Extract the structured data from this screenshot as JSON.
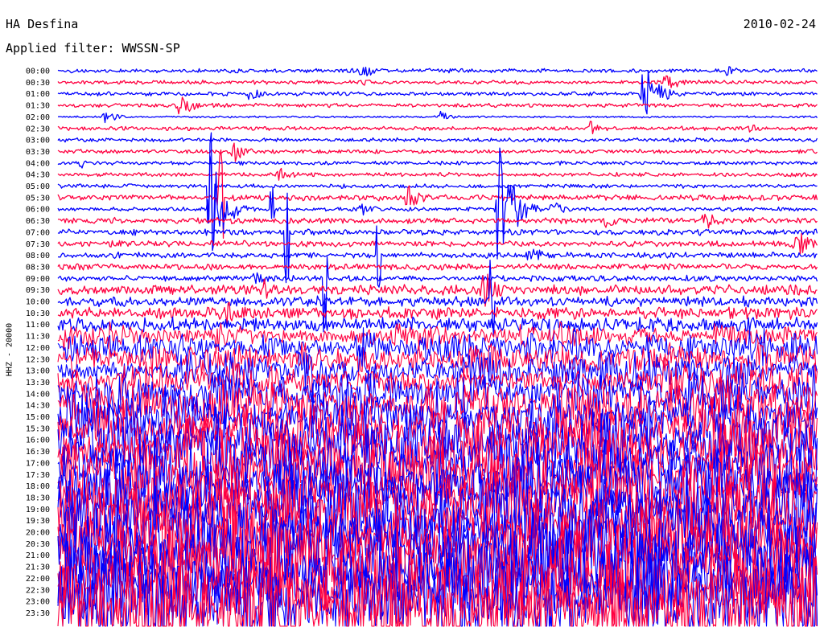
{
  "header": {
    "station": "HA Desfina",
    "date": "2010-02-24",
    "filter_text": "Applied filter: WWSSN-SP",
    "channel_label": "HHZ - 20000"
  },
  "chart_data": {
    "type": "line",
    "title": "",
    "row_labels": [
      "00:00",
      "00:30",
      "01:00",
      "01:30",
      "02:00",
      "02:30",
      "03:00",
      "03:30",
      "04:00",
      "04:30",
      "05:00",
      "05:30",
      "06:00",
      "06:30",
      "07:00",
      "07:30",
      "08:00",
      "08:30",
      "09:00",
      "09:30",
      "10:00",
      "10:30",
      "11:00",
      "11:30",
      "12:00",
      "12:30",
      "13:00",
      "13:30",
      "14:00",
      "14:30",
      "15:00",
      "15:30",
      "16:00",
      "16:30",
      "17:00",
      "17:30",
      "18:00",
      "18:30",
      "19:00",
      "19:30",
      "20:00",
      "20:30",
      "21:00",
      "21:30",
      "22:00",
      "22:30",
      "23:00",
      "23:30"
    ],
    "trace_colors": [
      "#0000ff",
      "#ff0040"
    ],
    "row_noise_level": [
      2,
      2,
      2,
      2,
      1,
      2,
      2,
      2,
      2,
      2,
      2,
      3,
      2,
      3,
      3,
      3,
      3,
      3,
      3,
      5,
      5,
      6,
      7,
      9,
      10,
      12,
      14,
      16,
      18,
      20,
      21,
      22,
      24,
      26,
      28,
      30,
      31,
      32,
      33,
      34,
      35,
      36,
      37,
      38,
      38,
      39,
      40,
      40
    ],
    "events": [
      {
        "row": 0,
        "t": 0.4,
        "amp": 10
      },
      {
        "row": 0,
        "t": 0.88,
        "amp": 7
      },
      {
        "row": 1,
        "t": 0.8,
        "amp": 12
      },
      {
        "row": 1,
        "t": 0.4,
        "amp": 5
      },
      {
        "row": 2,
        "t": 0.25,
        "amp": 9
      },
      {
        "row": 2,
        "t": 0.77,
        "amp": 40
      },
      {
        "row": 3,
        "t": 0.16,
        "amp": 14
      },
      {
        "row": 4,
        "t": 0.06,
        "amp": 8
      },
      {
        "row": 4,
        "t": 0.5,
        "amp": 8
      },
      {
        "row": 5,
        "t": 0.7,
        "amp": 12
      },
      {
        "row": 5,
        "t": 0.91,
        "amp": 6
      },
      {
        "row": 7,
        "t": 0.23,
        "amp": 14
      },
      {
        "row": 8,
        "t": 0.03,
        "amp": 7
      },
      {
        "row": 9,
        "t": 0.29,
        "amp": 12
      },
      {
        "row": 11,
        "t": 0.46,
        "amp": 16
      },
      {
        "row": 12,
        "t": 0.2,
        "amp": 70
      },
      {
        "row": 12,
        "t": 0.58,
        "amp": 90
      },
      {
        "row": 12,
        "t": 0.65,
        "amp": 10
      },
      {
        "row": 12,
        "t": 0.4,
        "amp": 8
      },
      {
        "row": 13,
        "t": 0.72,
        "amp": 10
      },
      {
        "row": 13,
        "t": 0.85,
        "amp": 16
      },
      {
        "row": 15,
        "t": 0.97,
        "amp": 22
      },
      {
        "row": 16,
        "t": 0.62,
        "amp": 14
      },
      {
        "row": 18,
        "t": 0.26,
        "amp": 12
      },
      {
        "row": 19,
        "t": 0.56,
        "amp": 28
      },
      {
        "row": 19,
        "t": 0.27,
        "amp": 14
      },
      {
        "row": 21,
        "t": 0.22,
        "amp": 18
      }
    ],
    "spikes": [
      {
        "row": 10,
        "t": 0.2,
        "amp": 80
      },
      {
        "row": 11,
        "t": 0.213,
        "amp": 90
      },
      {
        "row": 12,
        "t": 0.28,
        "amp": 70
      },
      {
        "row": 14,
        "t": 0.3,
        "amp": 90
      },
      {
        "row": 16,
        "t": 0.42,
        "amp": 40
      },
      {
        "row": 18,
        "t": 0.35,
        "amp": 70
      },
      {
        "row": 20,
        "t": 0.57,
        "amp": 60
      },
      {
        "row": 22,
        "t": 0.65,
        "amp": 60
      },
      {
        "row": 24,
        "t": 0.93,
        "amp": 50
      },
      {
        "row": 26,
        "t": 0.4,
        "amp": 60
      },
      {
        "row": 28,
        "t": 0.88,
        "amp": 40
      },
      {
        "row": 30,
        "t": 0.5,
        "amp": 50
      }
    ]
  }
}
